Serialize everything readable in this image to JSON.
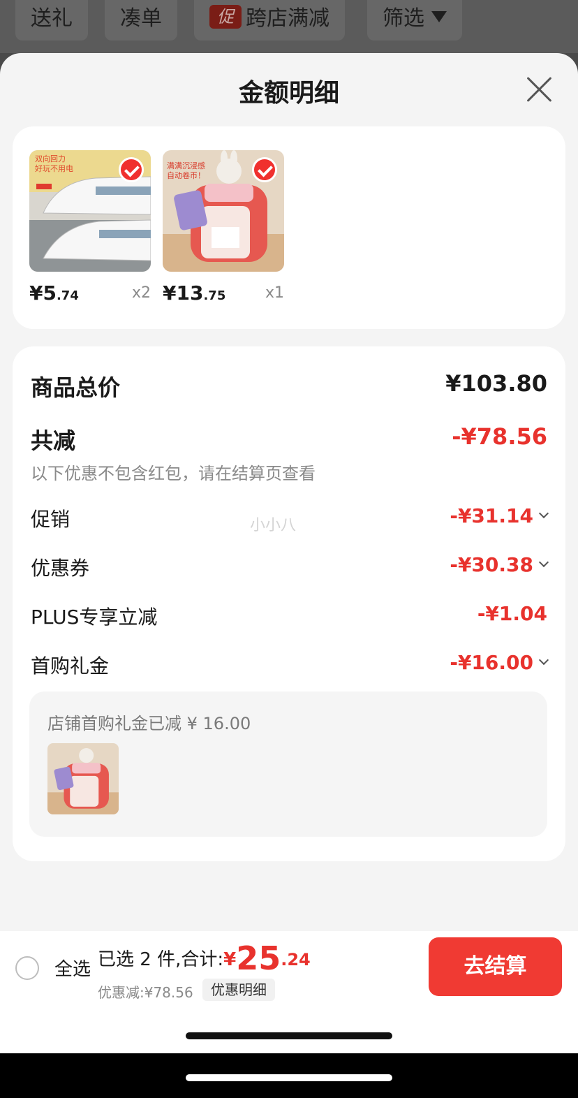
{
  "filter_bar": {
    "items": [
      {
        "label": "送礼"
      },
      {
        "label": "凑单"
      },
      {
        "badge": "促",
        "label": "跨店满减"
      },
      {
        "label": "筛选"
      }
    ]
  },
  "sheet": {
    "title": "金额明细",
    "products": [
      {
        "name": "train-toy",
        "price_int": "¥5",
        "price_dec": ".74",
        "qty": "x2",
        "image_text": "双向回力\n好玩不用电"
      },
      {
        "name": "piggy-bank",
        "price_int": "¥13",
        "price_dec": ".75",
        "qty": "x1",
        "image_text": "满满沉浸感\n自动卷币！"
      }
    ],
    "total": {
      "label": "商品总价",
      "value": "¥103.80"
    },
    "reduce": {
      "label": "共减",
      "value": "-¥78.56",
      "note": "以下优惠不包含红包，请在结算页查看"
    },
    "watermark": "小小八",
    "discounts": [
      {
        "label": "促销",
        "value": "-¥31.14",
        "expand": true
      },
      {
        "label": "优惠券",
        "value": "-¥30.38",
        "expand": true
      },
      {
        "label": "PLUS专享立减",
        "value": "-¥1.04",
        "expand": false
      },
      {
        "label": "首购礼金",
        "value": "-¥16.00",
        "expand": true
      }
    ],
    "gift": {
      "text": "店铺首购礼金已减 ¥ 16.00"
    }
  },
  "bottom": {
    "select_all": "全选",
    "summary_label": "已选 2 件,合计:",
    "currency": "¥",
    "total_int": "25",
    "total_dec": ".24",
    "saved": "优惠减:¥78.56",
    "detail_link": "优惠明细",
    "checkout": "去结算"
  },
  "colors": {
    "accent": "#f03a33",
    "discount": "#e8322d"
  }
}
